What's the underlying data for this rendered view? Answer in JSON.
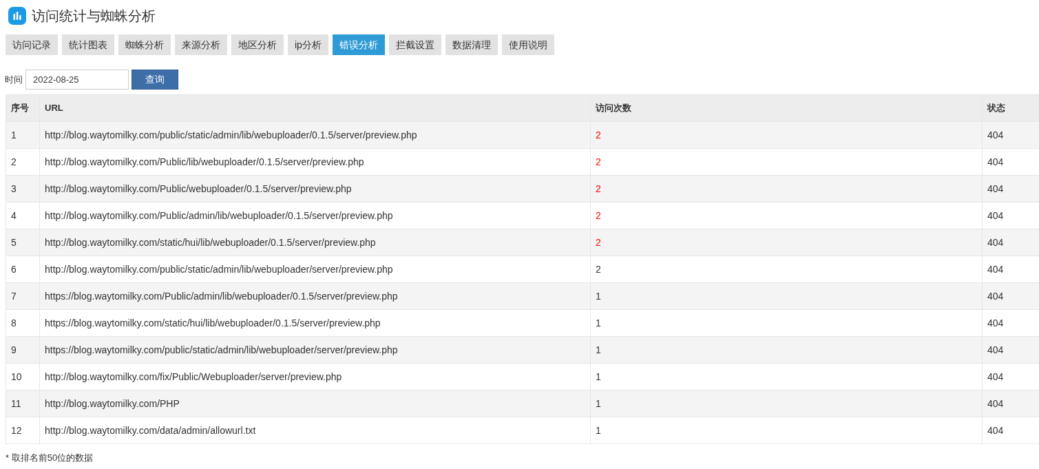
{
  "header": {
    "title": "访问统计与蜘蛛分析"
  },
  "tabs": [
    {
      "label": "访问记录",
      "selected": false
    },
    {
      "label": "统计图表",
      "selected": false
    },
    {
      "label": "蜘蛛分析",
      "selected": false
    },
    {
      "label": "来源分析",
      "selected": false
    },
    {
      "label": "地区分析",
      "selected": false
    },
    {
      "label": "ip分析",
      "selected": false
    },
    {
      "label": "错误分析",
      "selected": true
    },
    {
      "label": "拦截设置",
      "selected": false
    },
    {
      "label": "数据清理",
      "selected": false
    },
    {
      "label": "使用说明",
      "selected": false
    }
  ],
  "filter": {
    "label": "时间",
    "value": "2022-08-25",
    "button": "查询"
  },
  "table": {
    "columns": [
      "序号",
      "URL",
      "访问次数",
      "状态"
    ],
    "rows": [
      {
        "index": "1",
        "url": "http://blog.waytomilky.com/public/static/admin/lib/webuploader/0.1.5/server/preview.php",
        "count": "2",
        "highlighted": true,
        "status": "404"
      },
      {
        "index": "2",
        "url": "http://blog.waytomilky.com/Public/lib/webuploader/0.1.5/server/preview.php",
        "count": "2",
        "highlighted": true,
        "status": "404"
      },
      {
        "index": "3",
        "url": "http://blog.waytomilky.com/Public/webuploader/0.1.5/server/preview.php",
        "count": "2",
        "highlighted": true,
        "status": "404"
      },
      {
        "index": "4",
        "url": "http://blog.waytomilky.com/Public/admin/lib/webuploader/0.1.5/server/preview.php",
        "count": "2",
        "highlighted": true,
        "status": "404"
      },
      {
        "index": "5",
        "url": "http://blog.waytomilky.com/static/hui/lib/webuploader/0.1.5/server/preview.php",
        "count": "2",
        "highlighted": true,
        "status": "404"
      },
      {
        "index": "6",
        "url": "http://blog.waytomilky.com/public/static/admin/lib/webuploader/server/preview.php",
        "count": "2",
        "highlighted": false,
        "status": "404"
      },
      {
        "index": "7",
        "url": "https://blog.waytomilky.com/Public/admin/lib/webuploader/0.1.5/server/preview.php",
        "count": "1",
        "highlighted": false,
        "status": "404"
      },
      {
        "index": "8",
        "url": "https://blog.waytomilky.com/static/hui/lib/webuploader/0.1.5/server/preview.php",
        "count": "1",
        "highlighted": false,
        "status": "404"
      },
      {
        "index": "9",
        "url": "https://blog.waytomilky.com/public/static/admin/lib/webuploader/server/preview.php",
        "count": "1",
        "highlighted": false,
        "status": "404"
      },
      {
        "index": "10",
        "url": "http://blog.waytomilky.com/fix/Public/Webuploader/server/preview.php",
        "count": "1",
        "highlighted": false,
        "status": "404"
      },
      {
        "index": "11",
        "url": "http://blog.waytomilky.com/PHP",
        "count": "1",
        "highlighted": false,
        "status": "404"
      },
      {
        "index": "12",
        "url": "http://blog.waytomilky.com/data/admin/allowurl.txt",
        "count": "1",
        "highlighted": false,
        "status": "404"
      }
    ]
  },
  "footnote": "* 取排名前50位的数据"
}
